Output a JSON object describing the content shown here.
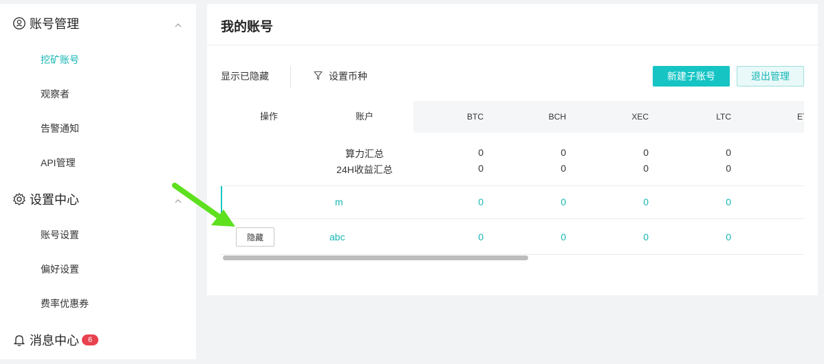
{
  "sidebar": {
    "account_section": {
      "label": "账号管理",
      "icon": "user-circle-icon"
    },
    "account_items": [
      "挖矿账号",
      "观察者",
      "告警通知",
      "API管理"
    ],
    "settings_section": {
      "label": "设置中心",
      "icon": "gear-icon"
    },
    "settings_items": [
      "账号设置",
      "偏好设置",
      "费率优惠券"
    ],
    "message_section": {
      "label": "消息中心",
      "icon": "bell-icon",
      "badge": "6"
    }
  },
  "main": {
    "title": "我的账号",
    "toolbar": {
      "show_hidden": "显示已隐藏",
      "set_currency": "设置币种",
      "new_sub_account": "新建子账号",
      "exit_manage": "退出管理"
    },
    "table": {
      "headers": {
        "action": "操作",
        "account": "账户"
      },
      "coins": [
        "BTC",
        "BCH",
        "XEC",
        "LTC",
        "ET"
      ],
      "summary_rows": [
        {
          "label": "算力汇总",
          "values": [
            "0",
            "0",
            "0",
            "0"
          ]
        },
        {
          "label": "24H收益汇总",
          "values": [
            "0",
            "0",
            "0",
            "0"
          ]
        }
      ],
      "rows": [
        {
          "account": "m",
          "values": [
            "0",
            "0",
            "0",
            "0"
          ]
        },
        {
          "account": "abc",
          "action": "隐藏",
          "values": [
            "0",
            "0",
            "0",
            "0"
          ]
        }
      ]
    }
  },
  "colors": {
    "accent": "#16c4c4",
    "badge": "#e8424f",
    "arrow": "#5ee01e"
  }
}
